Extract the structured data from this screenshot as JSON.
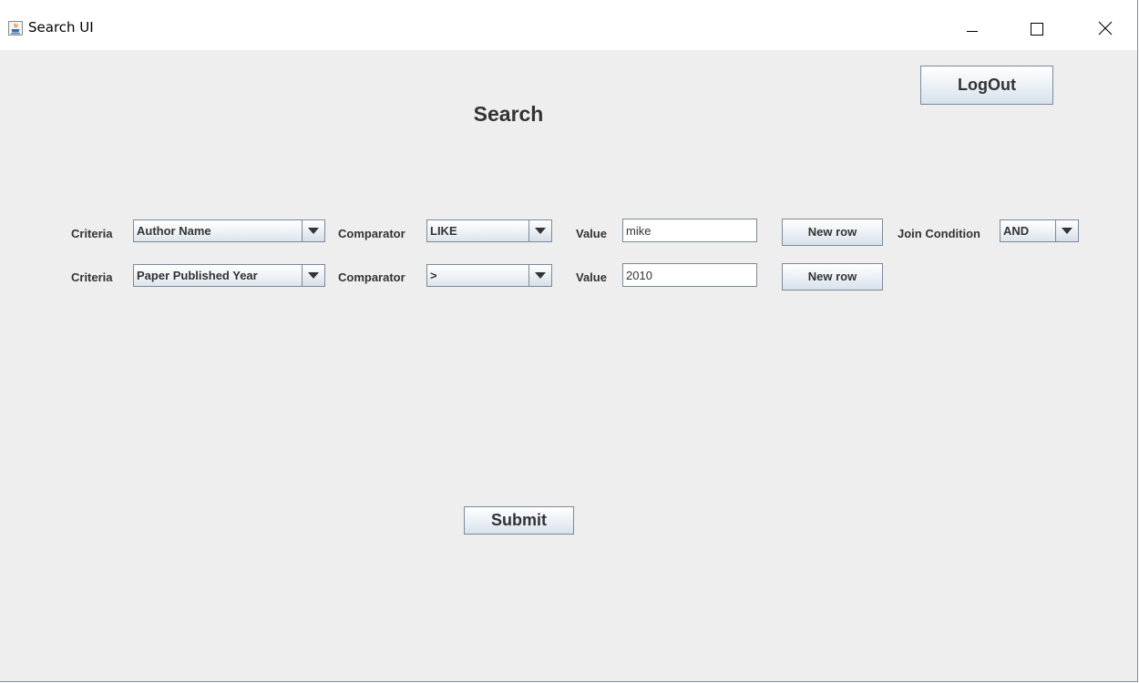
{
  "window": {
    "title": "Search UI",
    "controls": {
      "minimize_icon": "minimize-icon",
      "maximize_icon": "maximize-icon",
      "close_icon": "close-icon"
    }
  },
  "header": {
    "title": "Search",
    "logout_label": "LogOut"
  },
  "rows": [
    {
      "criteria_label": "Criteria",
      "criteria_value": "Author Name",
      "comparator_label": "Comparator",
      "comparator_value": "LIKE",
      "value_label": "Value",
      "value": "mike",
      "new_row_label": "New row",
      "join_label": "Join Condition",
      "join_value": "AND"
    },
    {
      "criteria_label": "Criteria",
      "criteria_value": "Paper Published Year",
      "comparator_label": "Comparator",
      "comparator_value": ">",
      "value_label": "Value",
      "value": "2010",
      "new_row_label": "New row"
    }
  ],
  "footer": {
    "submit_label": "Submit"
  },
  "colors": {
    "panel_background": "#eeeeee",
    "label_text": "#333333",
    "border": "#7a8a99"
  }
}
